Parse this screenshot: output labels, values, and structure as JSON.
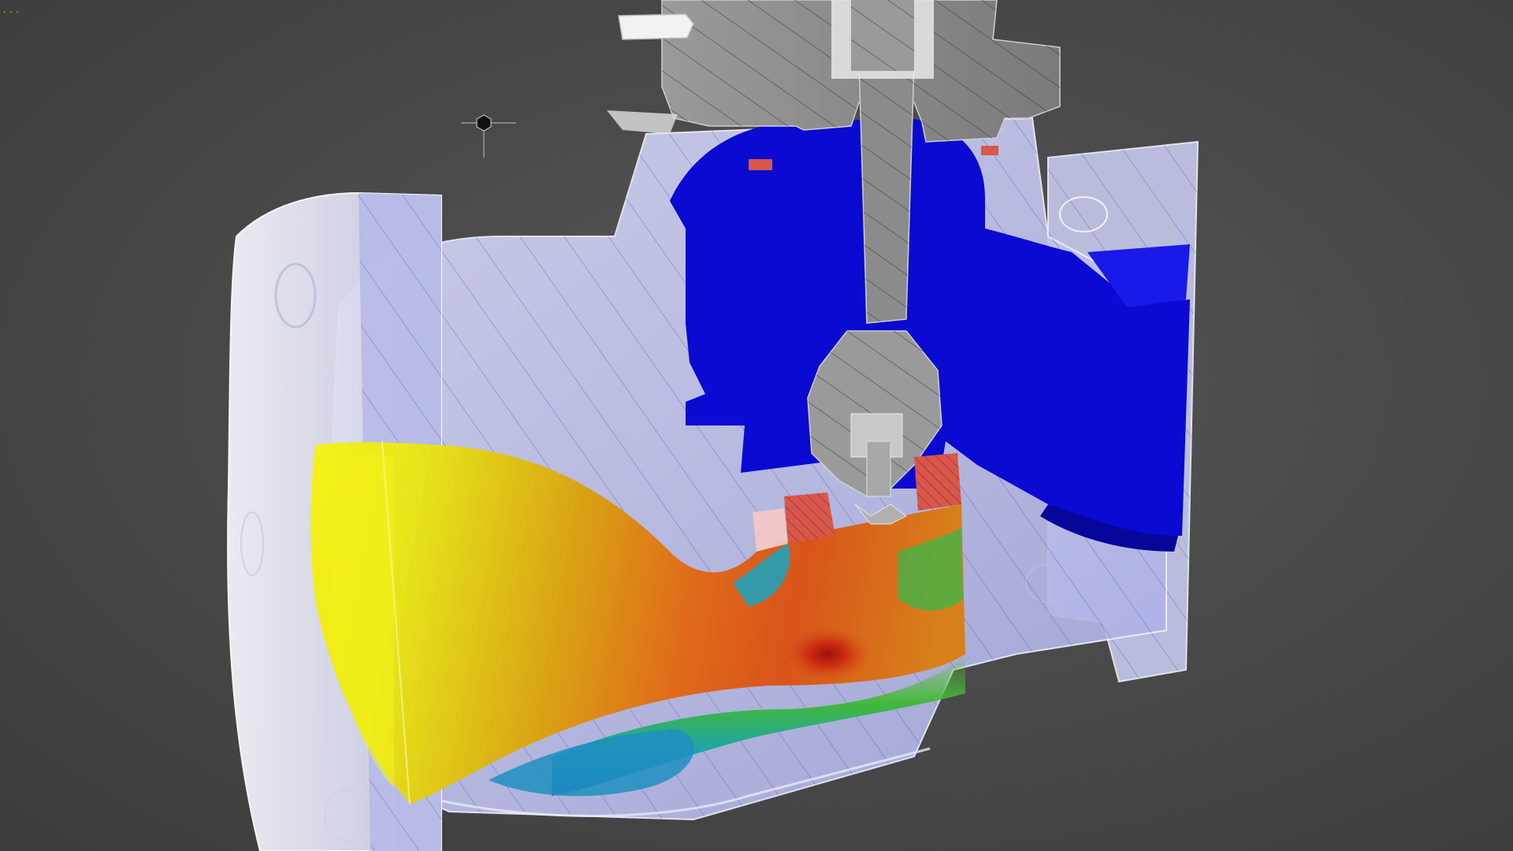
{
  "viewport": {
    "corner_indicator": "..."
  },
  "scene": {
    "subject": "globe-valve-section",
    "palette": {
      "background": "#4a4a4a",
      "valve_body": "#b8bce8",
      "valve_body_edge": "#e6e8ff",
      "flange_white": "#e9eaf3",
      "bonnet_steel": "#8e8e8e",
      "fluid_outlet": "#0a0ad6",
      "seal_red": "#d8574a",
      "contour_high": "#d22a10",
      "contour_mid": "#f0d000",
      "contour_low": "#1a68d0"
    },
    "icons": {
      "pivot": "hexagon-pivot-icon"
    }
  }
}
